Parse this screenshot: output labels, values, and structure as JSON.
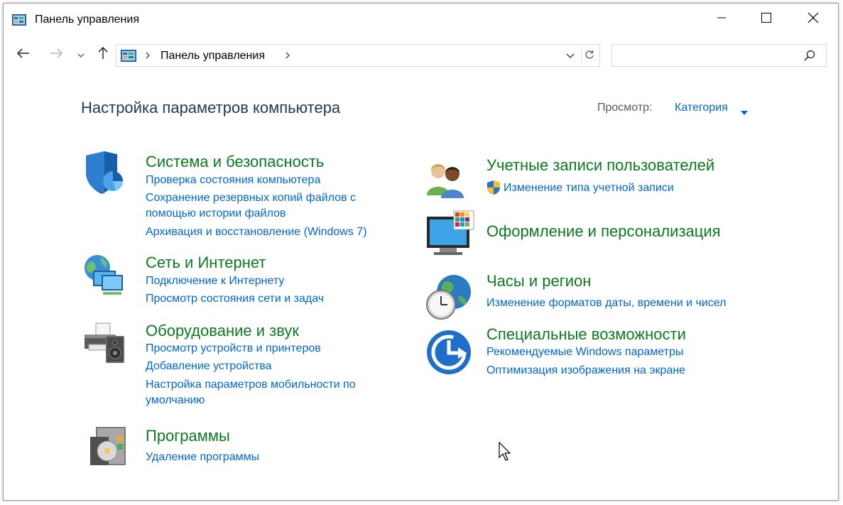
{
  "window": {
    "title": "Панель управления"
  },
  "navigation": {
    "breadcrumb": "Панель управления",
    "search_placeholder": ""
  },
  "content": {
    "page_title": "Настройка параметров компьютера",
    "view_by_label": "Просмотр:",
    "view_by_value": "Категория"
  },
  "categories": {
    "system_security": {
      "title": "Система и безопасность",
      "links": [
        "Проверка состояния компьютера",
        "Сохранение резервных копий файлов с",
        "помощью истории файлов",
        "Архивация и восстановление (Windows 7)"
      ]
    },
    "network": {
      "title": "Сеть и Интернет",
      "links": [
        "Подключение к Интернету",
        "Просмотр состояния сети и задач"
      ]
    },
    "hardware": {
      "title": "Оборудование и звук",
      "links": [
        "Просмотр устройств и принтеров",
        "Добавление устройства",
        "Настройка параметров мобильности по",
        "умолчанию"
      ]
    },
    "programs": {
      "title": "Программы",
      "links": [
        "Удаление программы"
      ]
    },
    "user_accounts": {
      "title": "Учетные записи пользователей",
      "links": [
        "Изменение типа учетной записи"
      ]
    },
    "appearance": {
      "title": "Оформление и персонализация",
      "links": []
    },
    "clock_region": {
      "title": "Часы и регион",
      "links": [
        "Изменение форматов даты, времени и чисел"
      ]
    },
    "ease_of_access": {
      "title": "Специальные возможности",
      "links": [
        "Рекомендуемые Windows параметры",
        "Оптимизация изображения на экране"
      ]
    }
  },
  "colors": {
    "category_title": "#0b7a1f",
    "link": "#0066cc",
    "page_title": "#1e395b"
  }
}
